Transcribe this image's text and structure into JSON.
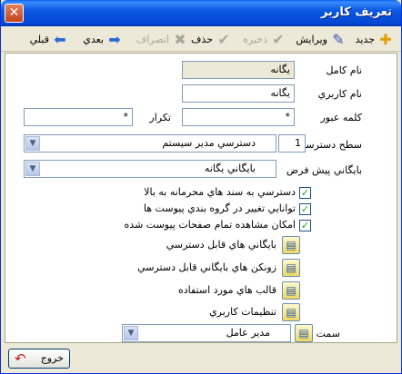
{
  "window": {
    "title": "تعريف كاربر",
    "close_glyph": "✕"
  },
  "toolbar": {
    "new_label": "جديد",
    "edit_label": "ويرايش",
    "save_label": "ذخيره",
    "delete_label": "حذف",
    "cancel_label": "انصراف",
    "next_label": "بعدي",
    "previous_label": "قبلي",
    "icons": {
      "new": "plus-icon",
      "edit": "edit-icon",
      "save": "check-icon",
      "delete": "checkmark-icon",
      "cancel": "cancel-icon",
      "next": "arrow-right-icon",
      "previous": "arrow-left-icon"
    }
  },
  "form": {
    "full_name_label": "نام كامل",
    "full_name_value": "يگانه",
    "username_label": "نام كاربري",
    "username_value": "يگانه",
    "password_label": "كلمه عبور",
    "password_value": "*",
    "repeat_label": "تكرار",
    "repeat_value": "*",
    "access_level_label": "سطح دسترسي",
    "access_level_value": "1",
    "access_level_option": "دسترسي مدير سيستم",
    "default_archive_label": "بايگاني پيش فرض",
    "default_archive_value": "بايگاني يگانه",
    "checkbox_classified": "دسترسي به سند هاي محرمانه به بالا",
    "checkbox_change_groups": "توانايي تغيير در گروه بندي پيوست ها",
    "checkbox_view_pages": "امكان مشاهده تمام صفحات پيوست شده",
    "archives_accessible": "بايگاني هاي قابل دسترسي",
    "archive_zones_accessible": "زونكن هاي بايگاني قابل دسترسي",
    "templates_used": "قالب هاي مورد استفاده",
    "user_settings": "تنظيمات كاربري",
    "position_label": "سمت",
    "position_value": "مدير عامل"
  },
  "footer": {
    "exit_label": "خروج"
  },
  "colors": {
    "titlebar": "#0447d6",
    "window_bg": "#ece9d8",
    "input_border": "#7f9db9",
    "disabled_text": "#a8a79c"
  }
}
